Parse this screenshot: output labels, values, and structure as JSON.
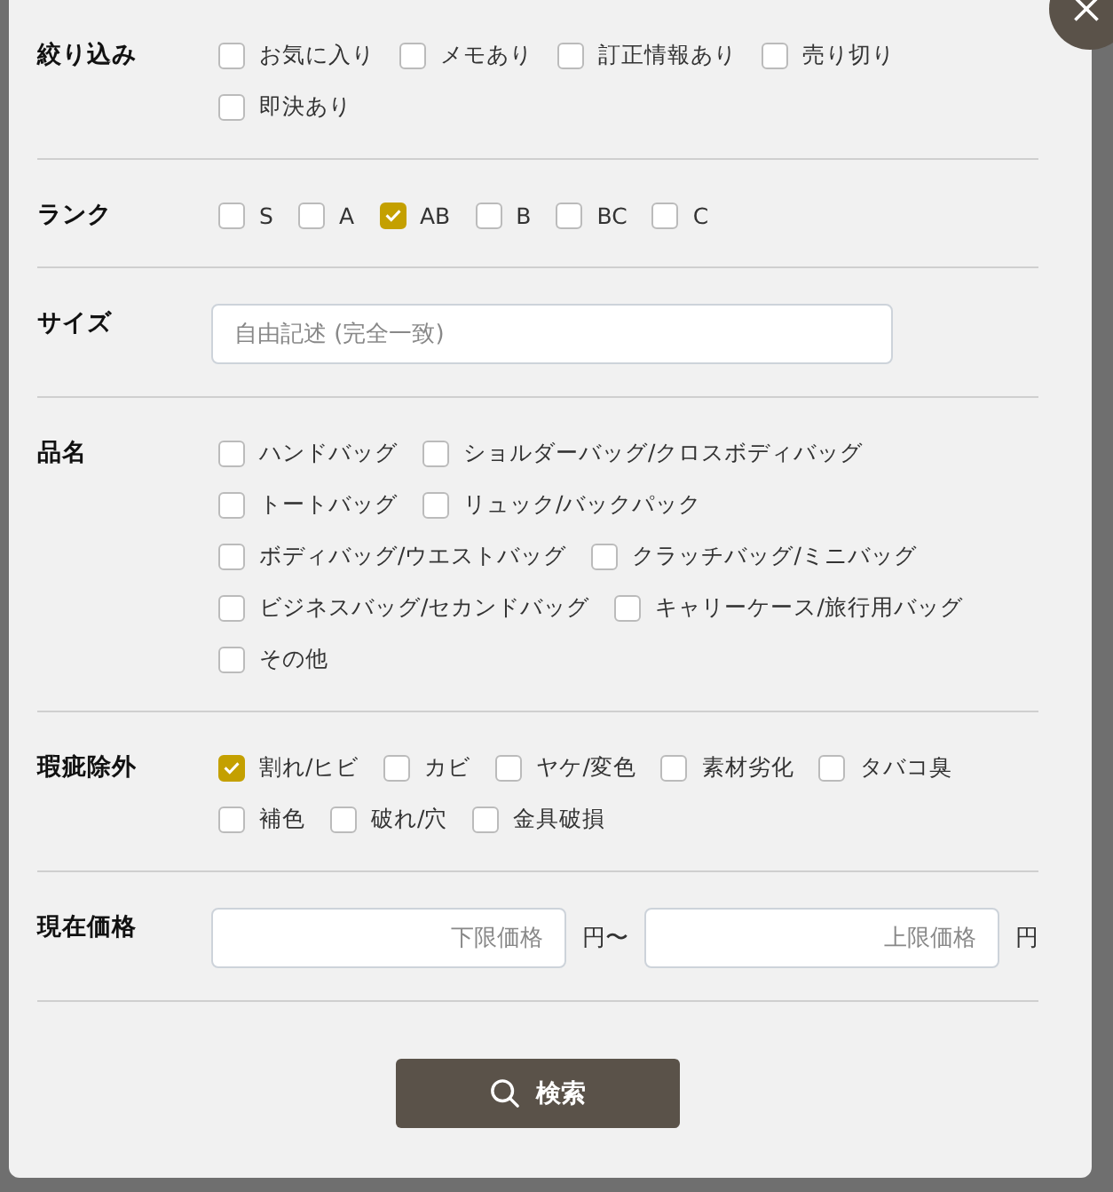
{
  "sections": [
    {
      "label": "絞り込み",
      "kind": "checkboxes",
      "options": [
        {
          "label": "お気に入り",
          "checked": false
        },
        {
          "label": "メモあり",
          "checked": false
        },
        {
          "label": "訂正情報あり",
          "checked": false
        },
        {
          "label": "売り切り",
          "checked": false
        },
        {
          "label": "即決あり",
          "checked": false
        }
      ]
    },
    {
      "label": "ランク",
      "kind": "checkboxes",
      "options": [
        {
          "label": "S",
          "checked": false
        },
        {
          "label": "A",
          "checked": false
        },
        {
          "label": "AB",
          "checked": true
        },
        {
          "label": "B",
          "checked": false
        },
        {
          "label": "BC",
          "checked": false
        },
        {
          "label": "C",
          "checked": false
        }
      ]
    },
    {
      "label": "サイズ",
      "kind": "text",
      "placeholder": "自由記述 (完全一致)"
    },
    {
      "label": "品名",
      "kind": "checkboxes",
      "options": [
        {
          "label": "ハンドバッグ",
          "checked": false
        },
        {
          "label": "ショルダーバッグ/クロスボディバッグ",
          "checked": false
        },
        {
          "label": "トートバッグ",
          "checked": false
        },
        {
          "label": "リュック/バックパック",
          "checked": false
        },
        {
          "label": "ボディバッグ/ウエストバッグ",
          "checked": false
        },
        {
          "label": "クラッチバッグ/ミニバッグ",
          "checked": false
        },
        {
          "label": "ビジネスバッグ/セカンドバッグ",
          "checked": false
        },
        {
          "label": "キャリーケース/旅行用バッグ",
          "checked": false
        },
        {
          "label": "その他",
          "checked": false
        }
      ]
    },
    {
      "label": "瑕疵除外",
      "kind": "checkboxes",
      "options": [
        {
          "label": "割れ/ヒビ",
          "checked": true
        },
        {
          "label": "カビ",
          "checked": false
        },
        {
          "label": "ヤケ/変色",
          "checked": false
        },
        {
          "label": "素材劣化",
          "checked": false
        },
        {
          "label": "タバコ臭",
          "checked": false
        },
        {
          "label": "補色",
          "checked": false
        },
        {
          "label": "破れ/穴",
          "checked": false
        },
        {
          "label": "金具破損",
          "checked": false
        }
      ]
    },
    {
      "label": "現在価格",
      "kind": "range",
      "min_placeholder": "下限価格",
      "separator": "円〜",
      "max_placeholder": "上限価格",
      "unit": "円"
    }
  ],
  "search_button": "検索"
}
